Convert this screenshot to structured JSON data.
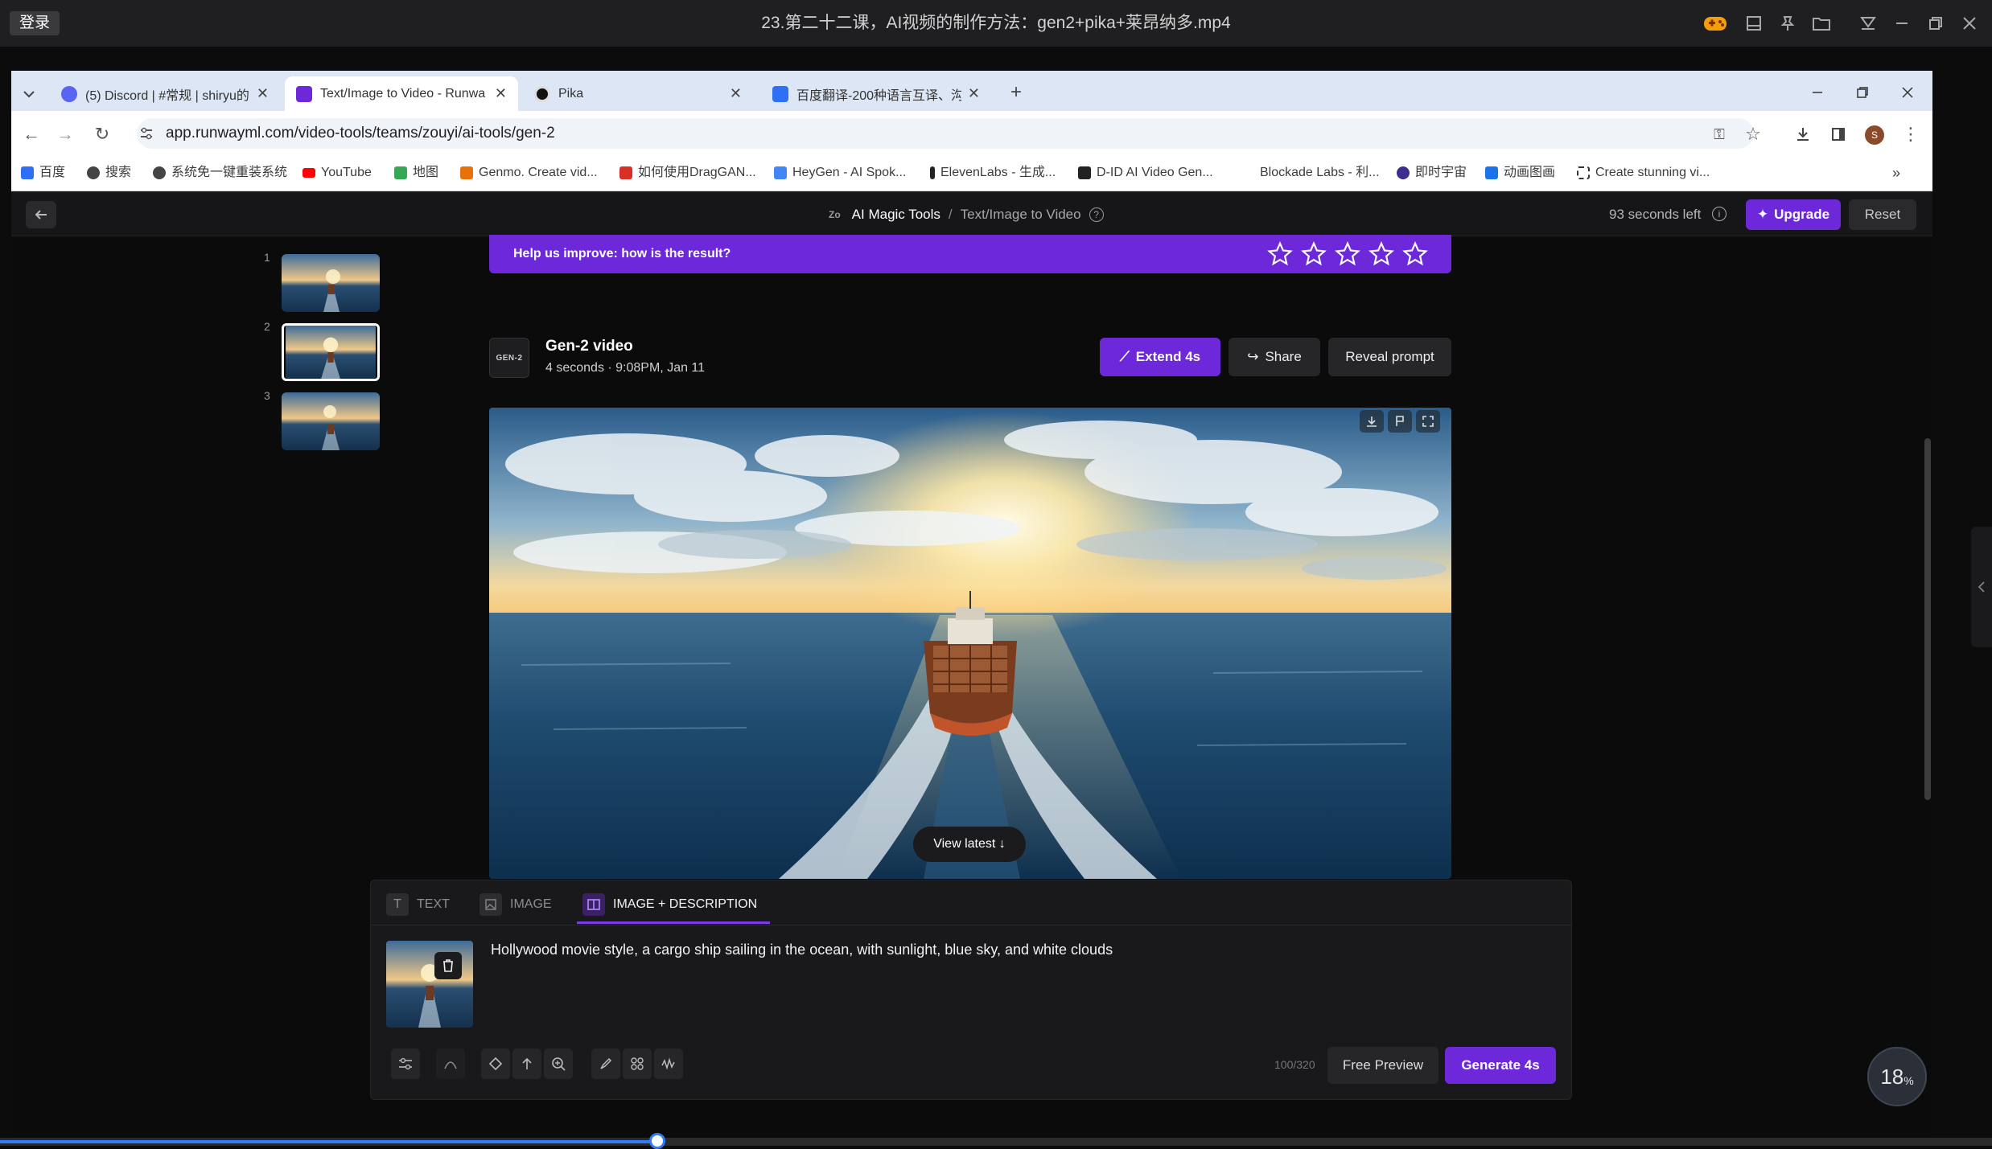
{
  "player": {
    "login_label": "登录",
    "title": "23.第二十二课，AI视频的制作方法：gen2+pika+莱昂纳多.mp4"
  },
  "browser": {
    "tabs": [
      {
        "label": "(5) Discord | #常规 | shiryu的",
        "active": false,
        "favicon_color": "#5865f2"
      },
      {
        "label": "Text/Image to Video - Runwa",
        "active": true,
        "favicon_color": "#6d28d9"
      },
      {
        "label": "Pika",
        "active": false,
        "favicon_color": "#111111"
      },
      {
        "label": "百度翻译-200种语言互译、沟通",
        "active": false,
        "favicon_color": "#2f6ff5"
      }
    ],
    "new_tab_label": "+",
    "url": "app.runwayml.com/video-tools/teams/zouyi/ai-tools/gen-2",
    "profile_initial": "S",
    "bookmarks": [
      {
        "label": "百度",
        "color": "#2f6ff5"
      },
      {
        "label": "搜索",
        "color": "#444444"
      },
      {
        "label": "系统免一键重装系统",
        "color": "#444444"
      },
      {
        "label": "YouTube",
        "color": "#ff0000"
      },
      {
        "label": "地图",
        "color": "#34a853"
      },
      {
        "label": "Genmo. Create vid...",
        "color": "#e8710a"
      },
      {
        "label": "如何使用DragGAN...",
        "color": "#d93025"
      },
      {
        "label": "HeyGen - AI Spok...",
        "color": "#4285f4"
      },
      {
        "label": "ElevenLabs - 生成...",
        "color": "#222222"
      },
      {
        "label": "D-ID AI Video Gen...",
        "color": "#222222"
      },
      {
        "label": "Blockade Labs - 利...",
        "color": "#999999"
      },
      {
        "label": "即时宇宙",
        "color": "#3b2e8c"
      },
      {
        "label": "动画图画",
        "color": "#1a73e8"
      },
      {
        "label": "Create stunning vi...",
        "color": "#333333"
      }
    ]
  },
  "app": {
    "breadcrumb_root": "AI Magic Tools",
    "breadcrumb_sep": "/",
    "breadcrumb_current": "Text/Image to Video",
    "time_left": "93 seconds left",
    "upgrade_label": "Upgrade",
    "reset_label": "Reset",
    "thumbnails": [
      {
        "number": "1",
        "selected": false
      },
      {
        "number": "2",
        "selected": true
      },
      {
        "number": "3",
        "selected": false
      }
    ],
    "feedback": {
      "text": "Help us improve: how is the result?",
      "stars": 5
    },
    "generation": {
      "logo_text": "GEN-2",
      "title": "Gen-2 video",
      "meta": "4 seconds · 9:08PM, Jan 11",
      "extend_label": "Extend 4s",
      "share_label": "Share",
      "reveal_label": "Reveal prompt"
    },
    "view_latest_label": "View latest ↓",
    "prompt": {
      "tabs": [
        {
          "label": "TEXT",
          "active": false
        },
        {
          "label": "IMAGE",
          "active": false
        },
        {
          "label": "IMAGE + DESCRIPTION",
          "active": true
        }
      ],
      "text": "Hollywood movie style, a cargo ship sailing in the ocean, with sunlight, blue sky, and white clouds",
      "counter": "100/320",
      "free_preview_label": "Free Preview",
      "generate_label": "Generate 4s"
    },
    "zoom_badge": "18",
    "zoom_badge_unit": "%"
  },
  "playback": {
    "progress_fraction": 0.33
  },
  "colors": {
    "accent": "#6d28d9",
    "player_bar": "#1f1f21",
    "app_bg": "#0b0b0c"
  }
}
